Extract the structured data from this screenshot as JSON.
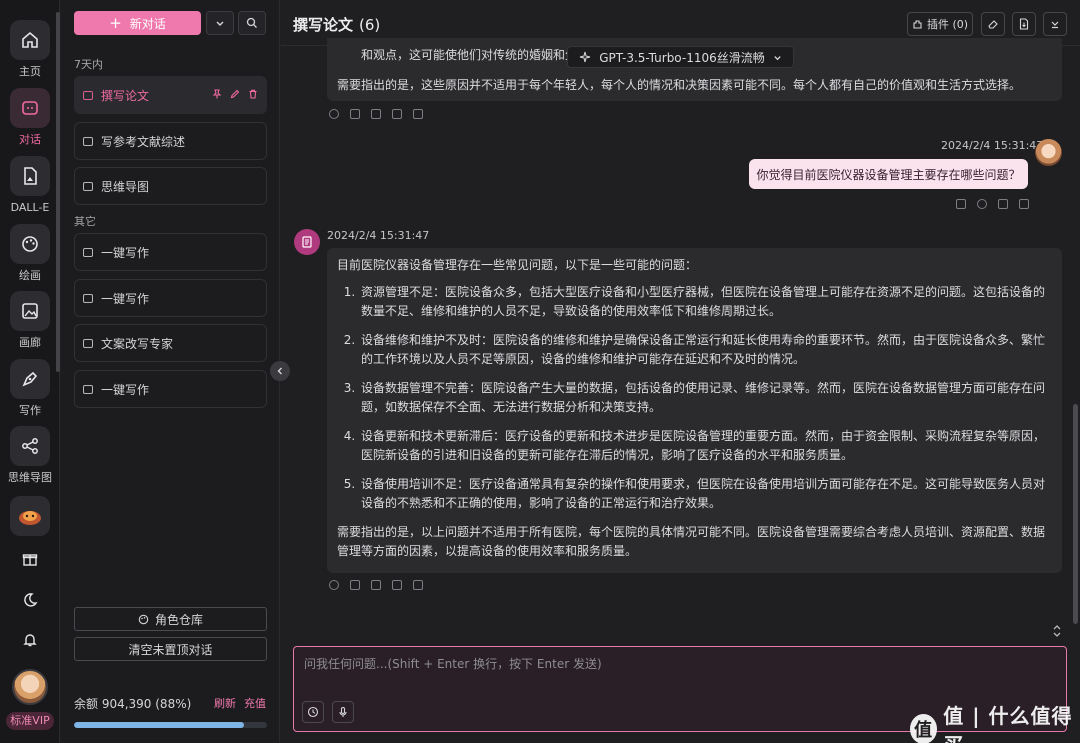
{
  "rail": {
    "items": [
      {
        "label": "主页",
        "icon": "home-icon"
      },
      {
        "label": "对话",
        "icon": "chat-icon"
      },
      {
        "label": "DALL-E",
        "icon": "image-file-icon"
      },
      {
        "label": "绘画",
        "icon": "palette-icon"
      },
      {
        "label": "画廊",
        "icon": "gallery-icon"
      },
      {
        "label": "写作",
        "icon": "pen-icon"
      },
      {
        "label": "思维导图",
        "icon": "mindmap-icon"
      }
    ],
    "extra_icons": [
      "gift-icon",
      "moon-icon",
      "bell-icon"
    ],
    "vip_label": "标准VIP"
  },
  "sidebar": {
    "new_chat_label": "新对话",
    "group_recent": "7天内",
    "group_other": "其它",
    "recent": [
      "撰写论文",
      "写参考文献综述",
      "思维导图"
    ],
    "other": [
      "一键写作",
      "一键写作",
      "文案改写专家",
      "一键写作"
    ],
    "role_warehouse_label": "角色仓库",
    "clear_label": "清空未置顶对话",
    "balance_text": "余额 904,390 (88%)",
    "balance_percent": 88,
    "refresh_label": "刷新",
    "recharge_label": "充值"
  },
  "header": {
    "title": "撰写论文",
    "count": "(6)",
    "plugin_label": "插件 (0)",
    "model_label": "GPT-3.5-Turbo-1106丝滑流畅"
  },
  "messages": {
    "prev_tail_1": "和观点，这可能使他们对传统的婚姻和生",
    "prev_tail_2": "需要指出的是，这些原因并不适用于每个年轻人，每个人的情况和决策因素可能不同。每个人都有自己的价值观和生活方式选择。",
    "user_time": "2024/2/4 15:31:47",
    "user_text": "你觉得目前医院仪器设备管理主要存在哪些问题？",
    "ai_time": "2024/2/4 15:31:47",
    "ai_intro": "目前医院仪器设备管理存在一些常见问题，以下是一些可能的问题：",
    "ai_points": [
      "资源管理不足：医院设备众多，包括大型医疗设备和小型医疗器械，但医院在设备管理上可能存在资源不足的问题。这包括设备的数量不足、维修和维护的人员不足，导致设备的使用效率低下和维修周期过长。",
      "设备维修和维护不及时：医院设备的维修和维护是确保设备正常运行和延长使用寿命的重要环节。然而，由于医院设备众多、繁忙的工作环境以及人员不足等原因，设备的维修和维护可能存在延迟和不及时的情况。",
      "设备数据管理不完善：医院设备产生大量的数据，包括设备的使用记录、维修记录等。然而，医院在设备数据管理方面可能存在问题，如数据保存不全面、无法进行数据分析和决策支持。",
      "设备更新和技术更新滞后：医疗设备的更新和技术进步是医院设备管理的重要方面。然而，由于资金限制、采购流程复杂等原因，医院新设备的引进和旧设备的更新可能存在滞后的情况，影响了医疗设备的水平和服务质量。",
      "设备使用培训不足：医疗设备通常具有复杂的操作和使用要求，但医院在设备使用培训方面可能存在不足。这可能导致医务人员对设备的不熟悉和不正确的使用，影响了设备的正常运行和治疗效果。"
    ],
    "ai_outro": "需要指出的是，以上问题并不适用于所有医院，每个医院的具体情况可能不同。医院设备管理需要综合考虑人员培训、资源配置、数据管理等方面的因素，以提高设备的使用效率和服务质量。"
  },
  "input": {
    "placeholder": "问我任何问题...(Shift + Enter 换行，按下 Enter 发送)"
  },
  "watermark": {
    "text": "值 | 什么值得买",
    "logo_char": "值"
  },
  "colors": {
    "accent": "#ef79ad",
    "background": "#1f1f22",
    "progress": "#7fb4e6"
  }
}
